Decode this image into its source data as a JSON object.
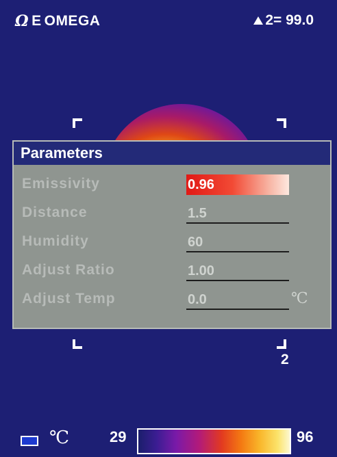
{
  "header": {
    "logo_mark": "Ω",
    "logo_sub": "E",
    "logo_text": "OMEGA",
    "readout_icon": "triangle-icon",
    "readout_text": "2= 99.0"
  },
  "target": {
    "spot_label": "2"
  },
  "dialog": {
    "title": "Parameters",
    "rows": [
      {
        "label": "Emissivity",
        "value": "0.96",
        "unit": ""
      },
      {
        "label": "Distance",
        "value": "1.5",
        "unit": ""
      },
      {
        "label": "Humidity",
        "value": "60",
        "unit": ""
      },
      {
        "label": "Adjust Ratio",
        "value": "1.00",
        "unit": ""
      },
      {
        "label": "Adjust Temp",
        "value": "0.0",
        "unit": "℃"
      }
    ]
  },
  "status_bar": {
    "unit": "℃",
    "scale_min": "29",
    "scale_max": "96"
  },
  "colors": {
    "background": "#1d1f74",
    "dialog_bg": "#8f9590",
    "title_bar": "#232a78",
    "selected_value": "#e11915"
  }
}
